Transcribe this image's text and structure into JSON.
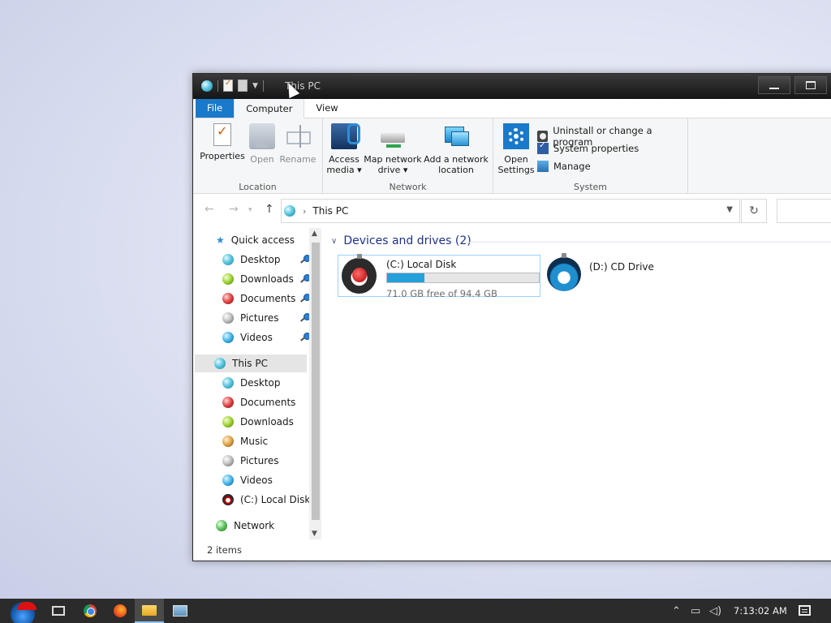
{
  "window": {
    "title": "This PC",
    "item_count": "2 items"
  },
  "tabs": [
    "File",
    "Computer",
    "View"
  ],
  "ribbon": {
    "location": {
      "label": "Location",
      "properties": "Properties",
      "open": "Open",
      "rename": "Rename"
    },
    "network": {
      "label": "Network",
      "access_media_line1": "Access",
      "access_media_line2": "media",
      "map_drive_line1": "Map network",
      "map_drive_line2": "drive",
      "add_location_line1": "Add a network",
      "add_location_line2": "location"
    },
    "system": {
      "label": "System",
      "open_settings_line1": "Open",
      "open_settings_line2": "Settings",
      "uninstall": "Uninstall or change a program",
      "system_properties": "System properties",
      "manage": "Manage"
    }
  },
  "address": {
    "crumb": "This PC"
  },
  "nav": {
    "quick_access": "Quick access",
    "quick_items": [
      "Desktop",
      "Downloads",
      "Documents",
      "Pictures",
      "Videos"
    ],
    "this_pc": "This PC",
    "pc_items": [
      "Desktop",
      "Documents",
      "Downloads",
      "Music",
      "Pictures",
      "Videos",
      "(C:) Local Disk"
    ],
    "network": "Network"
  },
  "content": {
    "section_title": "Devices and drives (2)",
    "drives": [
      {
        "name": "(C:) Local Disk",
        "free_text": "71.0 GB free of 94.4 GB",
        "used_fraction": 0.248
      },
      {
        "name": "(D:) CD Drive"
      }
    ]
  },
  "taskbar": {
    "clock": "7:13:02 AM"
  },
  "colors": {
    "accent": "#1979ca",
    "bar_fill": "#26a0da",
    "section_title": "#1e3287"
  }
}
